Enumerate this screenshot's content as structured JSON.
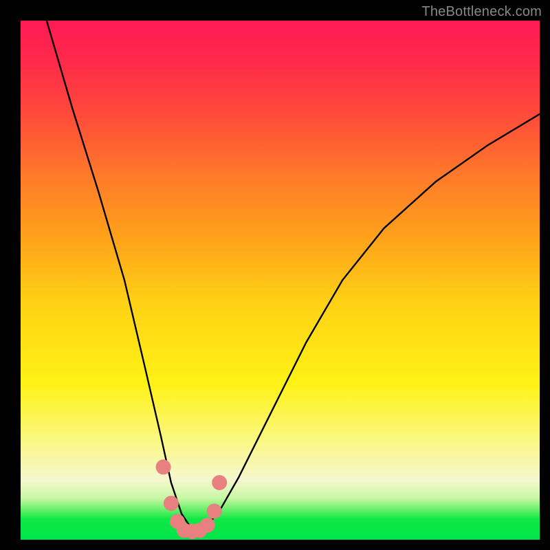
{
  "watermark": "TheBottleneck.com",
  "chart_data": {
    "type": "line",
    "title": "",
    "xlabel": "",
    "ylabel": "",
    "xlim": [
      0,
      100
    ],
    "ylim": [
      0,
      100
    ],
    "grid": false,
    "legend": false,
    "series": [
      {
        "name": "bottleneck-curve",
        "x": [
          5,
          10,
          15,
          20,
          24,
          27,
          29,
          31,
          33,
          35,
          38,
          42,
          48,
          55,
          62,
          70,
          80,
          90,
          100
        ],
        "y": [
          100,
          83,
          67,
          50,
          33,
          20,
          11,
          5,
          2,
          2,
          5,
          12,
          24,
          38,
          50,
          60,
          69,
          76,
          82
        ]
      }
    ],
    "markers": {
      "name": "highlight-points",
      "color": "#e98080",
      "x": [
        27.5,
        29.0,
        30.2,
        31.5,
        33.0,
        34.5,
        36.0,
        37.3,
        38.3
      ],
      "y": [
        14.0,
        7.0,
        3.5,
        1.8,
        1.6,
        1.8,
        2.8,
        5.5,
        11.0
      ]
    },
    "gradient_stops": [
      {
        "pos": 0,
        "color": "#ff1a55"
      },
      {
        "pos": 8,
        "color": "#ff2a4a"
      },
      {
        "pos": 18,
        "color": "#ff4a3a"
      },
      {
        "pos": 30,
        "color": "#ff7a2a"
      },
      {
        "pos": 42,
        "color": "#ffa31a"
      },
      {
        "pos": 55,
        "color": "#ffd315"
      },
      {
        "pos": 70,
        "color": "#fff215"
      },
      {
        "pos": 80,
        "color": "#fbf77a"
      },
      {
        "pos": 88.5,
        "color": "#f6f7cf"
      },
      {
        "pos": 92,
        "color": "#c8f7a4"
      },
      {
        "pos": 94.5,
        "color": "#5aef62"
      },
      {
        "pos": 96,
        "color": "#10e846"
      },
      {
        "pos": 100,
        "color": "#00e44a"
      }
    ]
  }
}
